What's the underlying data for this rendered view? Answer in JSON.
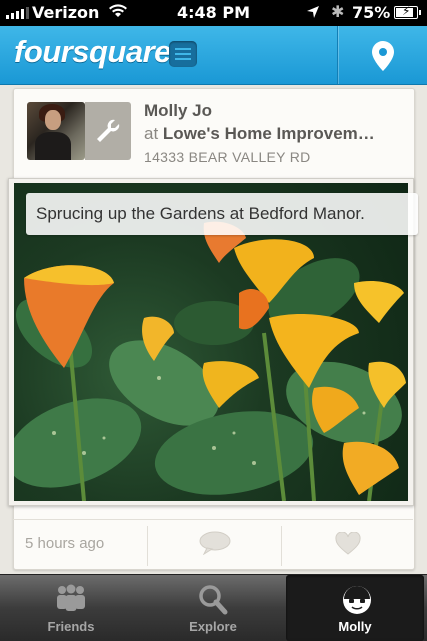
{
  "status_bar": {
    "carrier": "Verizon",
    "time": "4:48 PM",
    "battery": "75%",
    "battery_level": 0.75
  },
  "navbar": {
    "logo": "foursquare"
  },
  "checkin": {
    "user_name": "Molly Jo",
    "at_prefix": "at",
    "venue_name": "Lowe's Home Improvem…",
    "address": "14333 BEAR VALLEY RD",
    "caption": "Sprucing up the Gardens at Bedford Manor.",
    "timestamp": "5 hours ago"
  },
  "tabbar": {
    "tabs": [
      {
        "label": "Friends",
        "icon": "friends-icon"
      },
      {
        "label": "Explore",
        "icon": "search-icon"
      },
      {
        "label": "Molly",
        "icon": "profile-icon",
        "active": true
      }
    ]
  },
  "colors": {
    "nav_blue": "#1a98d5",
    "card_bg": "#fcfbf8",
    "tab_bg": "#2a2a2a"
  }
}
